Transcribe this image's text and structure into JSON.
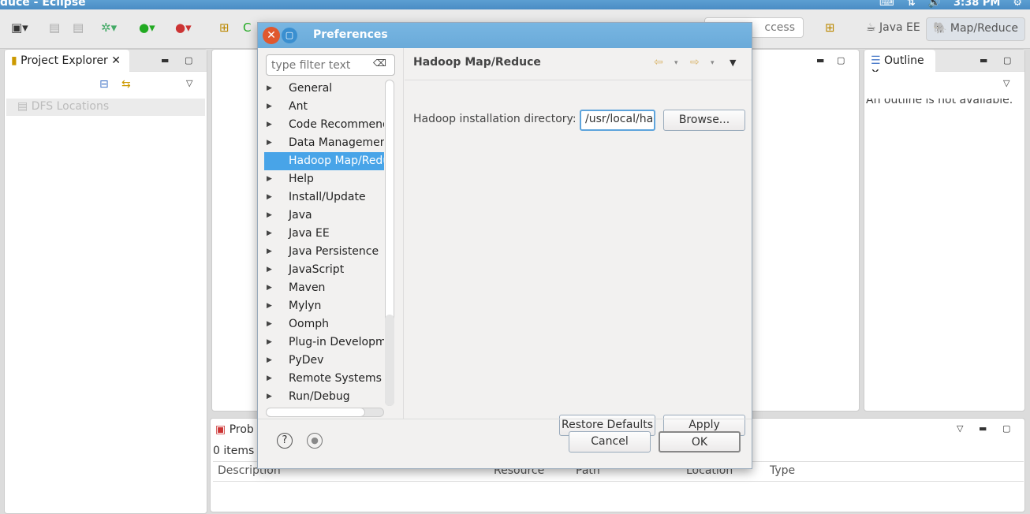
{
  "window": {
    "title": "duce - Eclipse",
    "clock": "3:38 PM"
  },
  "toolbar": {
    "quick_access": "ccess",
    "perspectives": [
      {
        "label": "Java EE"
      },
      {
        "label": "Map/Reduce",
        "active": true
      }
    ]
  },
  "project_explorer": {
    "tab": "Project Explorer",
    "items": [
      "DFS Locations"
    ]
  },
  "outline": {
    "tab": "Outline",
    "message": "An outline is not available."
  },
  "problems": {
    "tab": "Prob",
    "count": "0 items",
    "columns": [
      "Description",
      "Resource",
      "Path",
      "Location",
      "Type"
    ]
  },
  "dialog": {
    "title": "Preferences",
    "filter_placeholder": "type filter text",
    "tree": [
      "General",
      "Ant",
      "Code Recommend",
      "Data Management",
      "Hadoop Map/Redu",
      "Help",
      "Install/Update",
      "Java",
      "Java EE",
      "Java Persistence",
      "JavaScript",
      "Maven",
      "Mylyn",
      "Oomph",
      "Plug-in Developme",
      "PyDev",
      "Remote Systems",
      "Run/Debug"
    ],
    "selected_index": 4,
    "page_title": "Hadoop Map/Reduce",
    "field_label": "Hadoop installation directory:",
    "field_value": "/usr/local/hadoop",
    "browse": "Browse...",
    "restore": "Restore Defaults",
    "apply": "Apply",
    "cancel": "Cancel",
    "ok": "OK"
  }
}
